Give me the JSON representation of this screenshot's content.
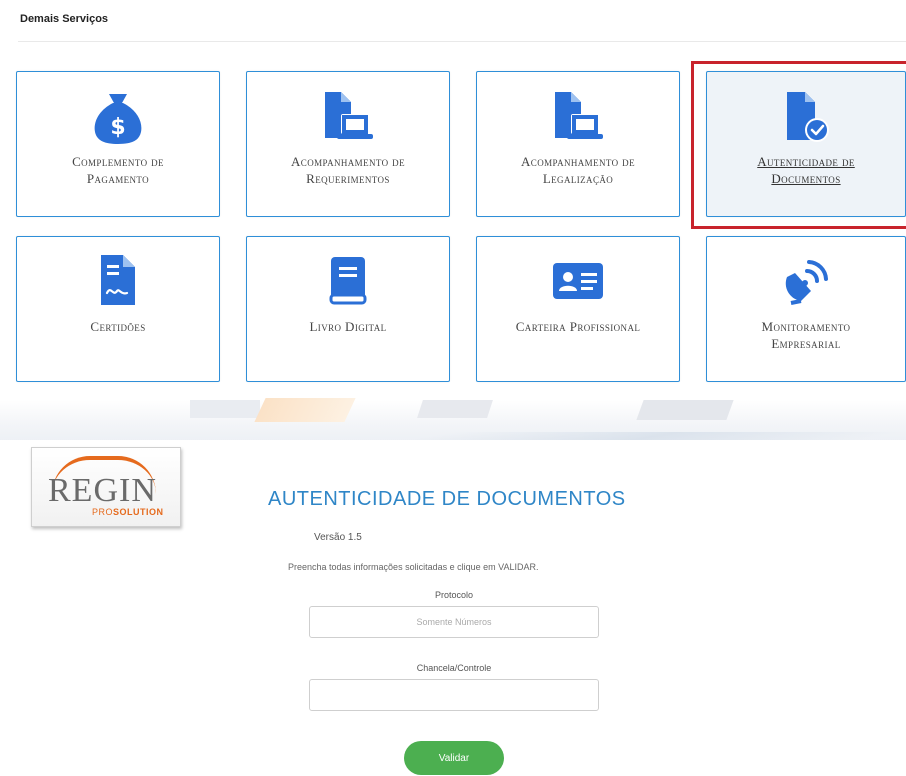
{
  "section_title": "Demais Serviços",
  "cards": [
    {
      "label": "Complemento de\nPagamento",
      "icon": "money-bag-icon"
    },
    {
      "label": "Acompanhamento de\nRequerimentos",
      "icon": "document-laptop-icon"
    },
    {
      "label": "Acompanhamento de\nLegalização",
      "icon": "document-laptop-icon"
    },
    {
      "label": "Autenticidade de\nDocumentos",
      "icon": "document-check-icon",
      "highlighted": true
    },
    {
      "label": "Certidões",
      "icon": "certificate-icon"
    },
    {
      "label": "Livro Digital",
      "icon": "book-icon"
    },
    {
      "label": "Carteira Profissional",
      "icon": "id-card-icon"
    },
    {
      "label": "Monitoramento\nEmpresarial",
      "icon": "satellite-dish-icon"
    }
  ],
  "logo": {
    "brand": "REGIN",
    "sub_a": "PRO",
    "sub_b": "SOLUTION"
  },
  "form": {
    "title": "AUTENTICIDADE DE DOCUMENTOS",
    "version": "Versão 1.5",
    "instructions": "Preencha todas informações solicitadas e clique em VALIDAR.",
    "protocol_label": "Protocolo",
    "protocol_placeholder": "Somente Números",
    "chancela_label": "Chancela/Controle",
    "chancela_placeholder": "",
    "validate_label": "Validar"
  },
  "colors": {
    "accent": "#2f86c7",
    "icon": "#2b6fd6",
    "highlight": "#c8232c",
    "button": "#4caf50"
  }
}
